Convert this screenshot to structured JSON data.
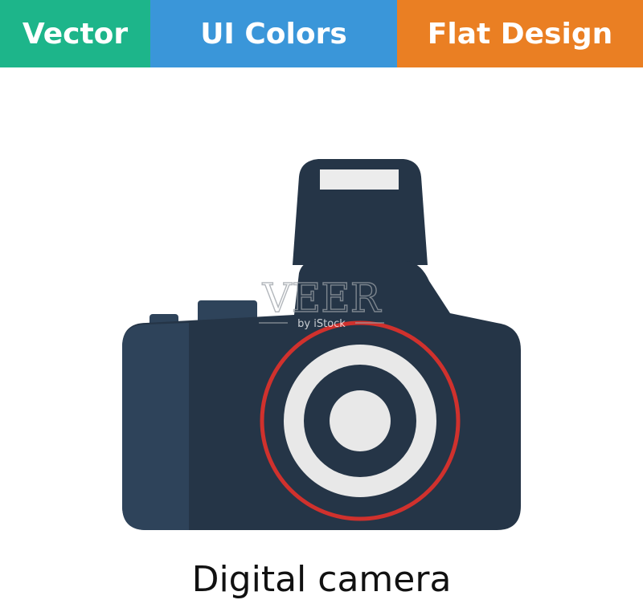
{
  "banner": {
    "tabs": [
      {
        "label": "Vector",
        "color": "#1db58a"
      },
      {
        "label": "UI Colors",
        "color": "#3a96d9"
      },
      {
        "label": "Flat Design",
        "color": "#ea7f23"
      }
    ]
  },
  "illustration": {
    "subject": "camera-icon",
    "colors": {
      "body": "#253547",
      "grip": "#2e435a",
      "lens_ring": "#d0312d",
      "lens_light": "#e8e8e8",
      "flash_window": "#ececec"
    },
    "watermark": {
      "title": "VEER",
      "subtitle": "by iStock"
    }
  },
  "caption": "Digital camera"
}
